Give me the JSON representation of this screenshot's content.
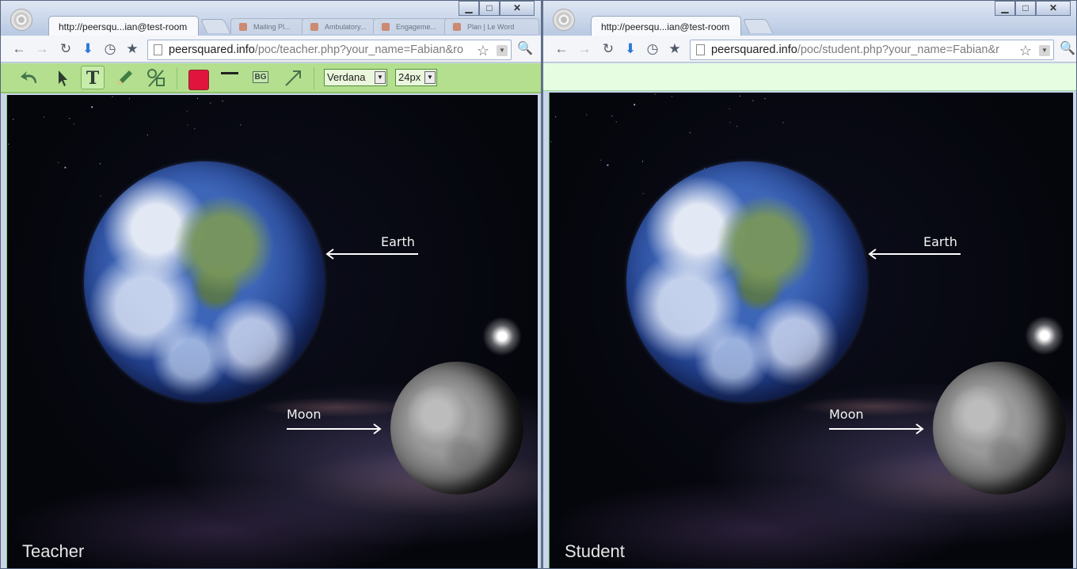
{
  "left_window": {
    "tab_title": "http://peersqu...ian@test-room",
    "background_tabs": [
      "Mailing Pl...",
      "Ambulatory...",
      "Engageme...",
      "Plan | Le Word"
    ],
    "url_host": "peersquared.info",
    "url_path": "/poc/teacher.php?your_name=Fabian&ro",
    "toolbar": {
      "tools": [
        "undo-icon",
        "select-arrow-icon",
        "text-tool-icon",
        "pencil-icon",
        "shapes-icon"
      ],
      "text_tool_glyph": "T",
      "color": "#e0143c",
      "bg_label": "BG",
      "font_family": "Verdana",
      "font_size": "24px",
      "dropdown_glyph": "▼"
    },
    "canvas": {
      "earth_label": "Earth",
      "moon_label": "Moon",
      "corner_label": "Teacher"
    }
  },
  "right_window": {
    "tab_title": "http://peersqu...ian@test-room",
    "url_host": "peersquared.info",
    "url_path": "/poc/student.php?your_name=Fabian&r",
    "canvas": {
      "earth_label": "Earth",
      "moon_label": "Moon",
      "corner_label": "Student"
    }
  },
  "window_controls": {
    "minimize": "▁",
    "maximize": "□",
    "close": "✕"
  },
  "nav": {
    "back": "←",
    "forward": "→",
    "reload": "↻",
    "download": "⬇",
    "history": "◷",
    "bookmark": "★",
    "star": "☆",
    "search": "🔍",
    "dropdown": "▼"
  },
  "colors": {
    "toolbar_green": "#b3df8e",
    "student_bar": "#e6fde2",
    "annotation_white": "#ffffff"
  }
}
